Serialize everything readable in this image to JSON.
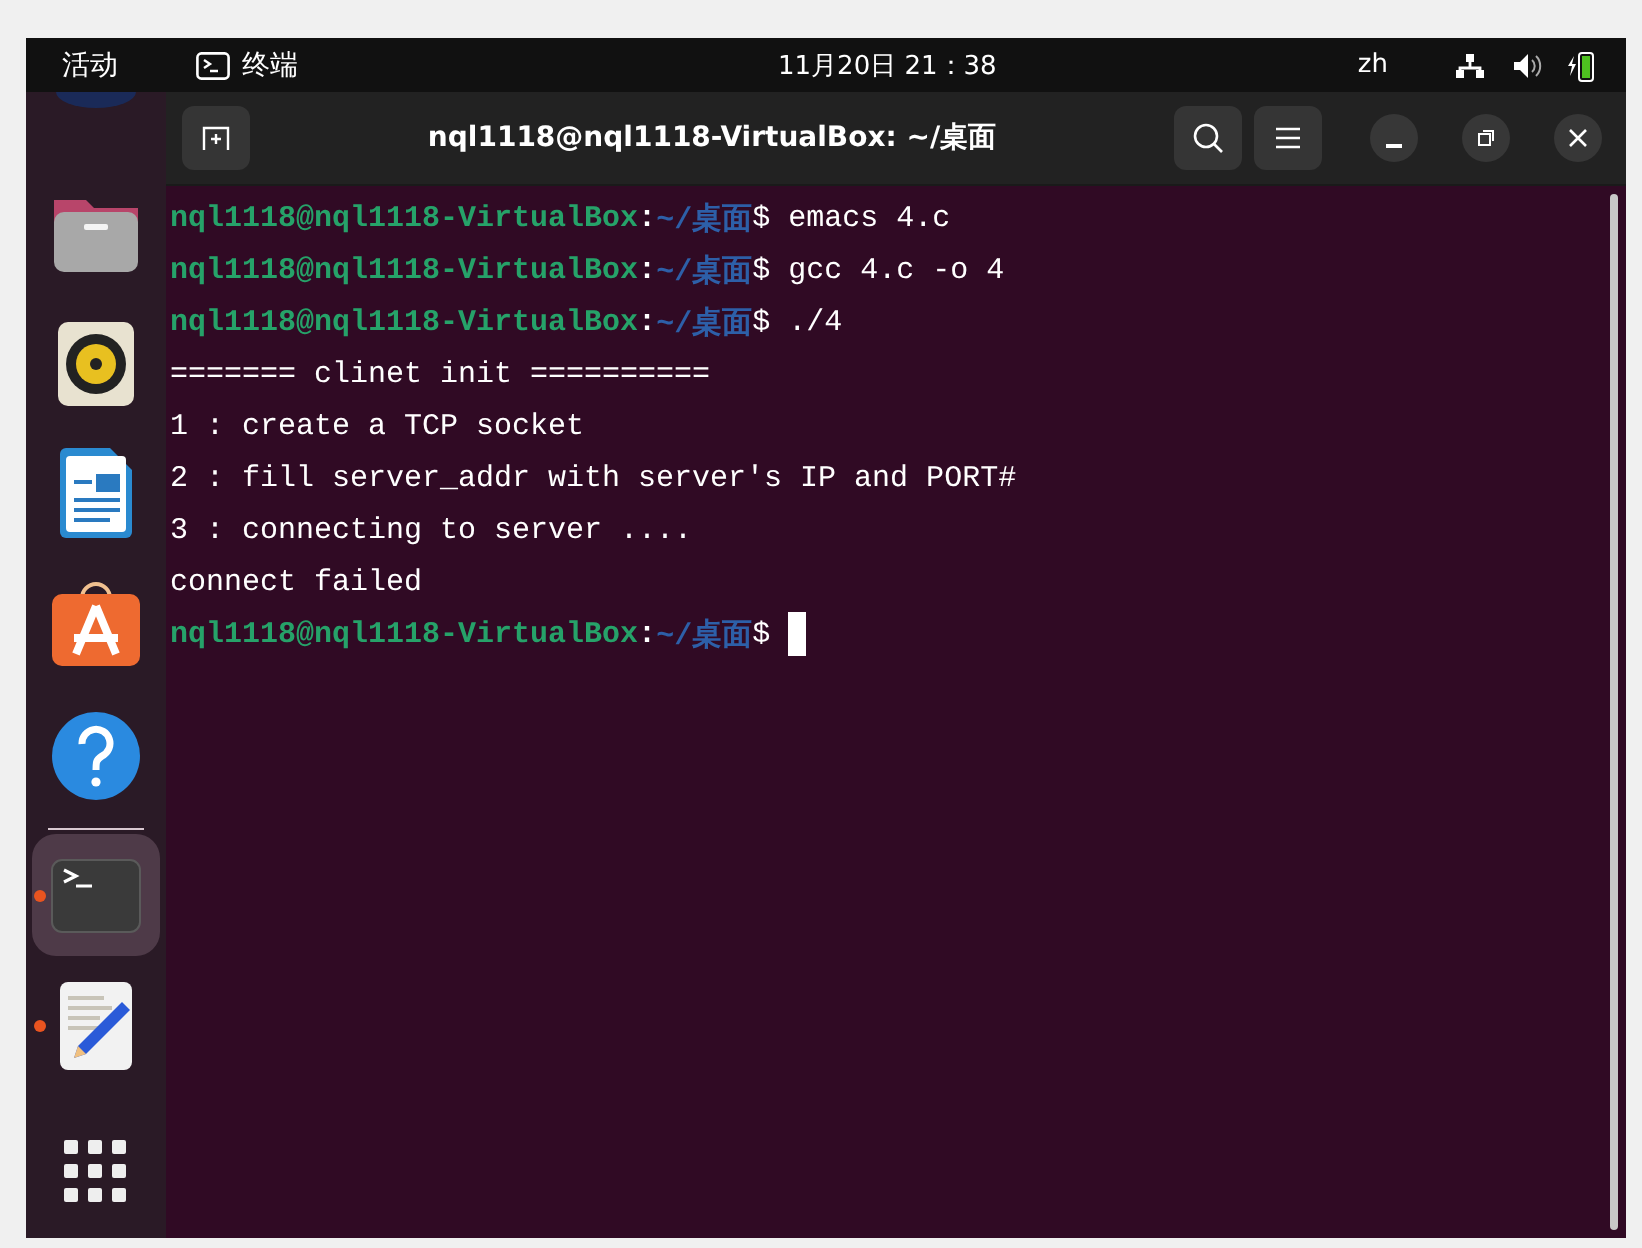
{
  "top_bar": {
    "activities": "活动",
    "app_name": "终端",
    "clock": "11月20日 21：38",
    "input_method": "zh"
  },
  "dock": [
    {
      "kind": "files",
      "running": false,
      "selected": false
    },
    {
      "kind": "music",
      "running": false,
      "selected": false
    },
    {
      "kind": "document",
      "running": false,
      "selected": false
    },
    {
      "kind": "store",
      "running": false,
      "selected": false
    },
    {
      "kind": "help",
      "running": false,
      "selected": false
    },
    {
      "kind": "terminal",
      "running": true,
      "selected": true
    },
    {
      "kind": "editor",
      "running": true,
      "selected": false
    },
    {
      "kind": "apps",
      "running": false,
      "selected": false
    }
  ],
  "terminal": {
    "title": "nql1118@nql1118-VirtualBox: ~/桌面",
    "lines": [
      {
        "kind": "prompt",
        "user": "nql1118@nql1118-VirtualBox",
        "sep": ":",
        "path": "~/桌面",
        "sign": "$",
        "command": "emacs 4.c"
      },
      {
        "kind": "prompt",
        "user": "nql1118@nql1118-VirtualBox",
        "sep": ":",
        "path": "~/桌面",
        "sign": "$",
        "command": "gcc 4.c -o 4"
      },
      {
        "kind": "prompt",
        "user": "nql1118@nql1118-VirtualBox",
        "sep": ":",
        "path": "~/桌面",
        "sign": "$",
        "command": "./4"
      },
      {
        "kind": "output",
        "text": "======= clinet init =========="
      },
      {
        "kind": "output",
        "text": "1 : create a TCP socket"
      },
      {
        "kind": "output",
        "text": "2 : fill server_addr with server's IP and PORT#"
      },
      {
        "kind": "output",
        "text": "3 : connecting to server ...."
      },
      {
        "kind": "output",
        "text": "connect failed"
      },
      {
        "kind": "prompt",
        "user": "nql1118@nql1118-VirtualBox",
        "sep": ":",
        "path": "~/桌面",
        "sign": "$",
        "cursor": true
      }
    ]
  }
}
